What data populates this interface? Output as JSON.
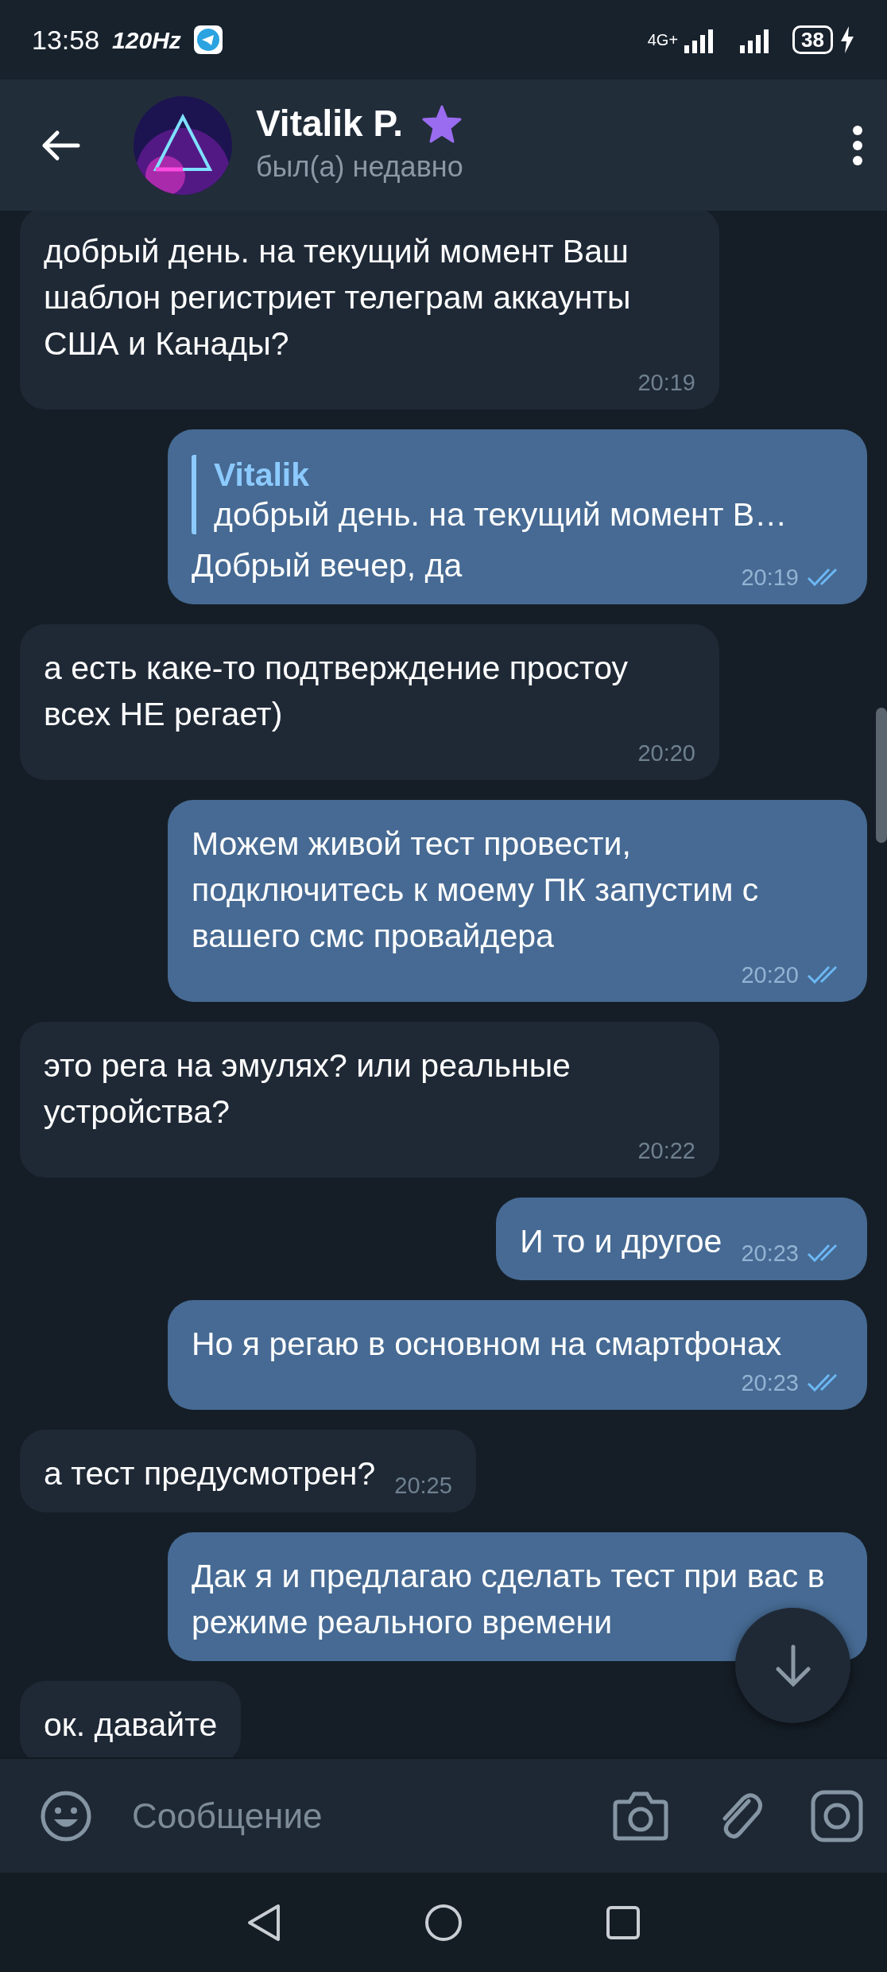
{
  "status_bar": {
    "time": "13:58",
    "refresh_rate": "120Hz",
    "network": "4G+",
    "battery": "38",
    "charging": true
  },
  "header": {
    "name": "Vitalik P.",
    "status": "был(а) недавно",
    "premium": true
  },
  "messages": [
    {
      "kind": "incoming",
      "text": "добрый день. на текущий момент Ваш шаблон регистриет телеграм аккаунты США и Канады?",
      "time": "20:19"
    },
    {
      "kind": "outgoing",
      "reply": {
        "name": "Vitalik",
        "text": "добрый день. на текущий момент В…"
      },
      "text": "Добрый вечер, да",
      "time": "20:19",
      "read": true
    },
    {
      "kind": "incoming",
      "text": "а есть каке-то подтверждение простоу всех НЕ регает)",
      "time": "20:20"
    },
    {
      "kind": "outgoing",
      "text": "Можем живой тест провести, подключитесь к моему ПК запустим с вашего смс провайдера",
      "time": "20:20",
      "read": true
    },
    {
      "kind": "incoming",
      "text": "это рега на эмулях? или реальные устройства?",
      "time": "20:22"
    },
    {
      "kind": "outgoing",
      "text": "И то и другое",
      "time": "20:23",
      "read": true
    },
    {
      "kind": "outgoing",
      "text": "Но я регаю в основном на смартфонах",
      "time": "20:23",
      "read": true
    },
    {
      "kind": "incoming",
      "text": "а тест предусмотрен?",
      "time": "20:25"
    },
    {
      "kind": "outgoing",
      "text": "Дак я и предлагаю сделать тест при вас в режиме реального времени"
    },
    {
      "kind": "incoming",
      "text": "ок. давайте"
    }
  ],
  "composer": {
    "placeholder": "Сообщение"
  }
}
